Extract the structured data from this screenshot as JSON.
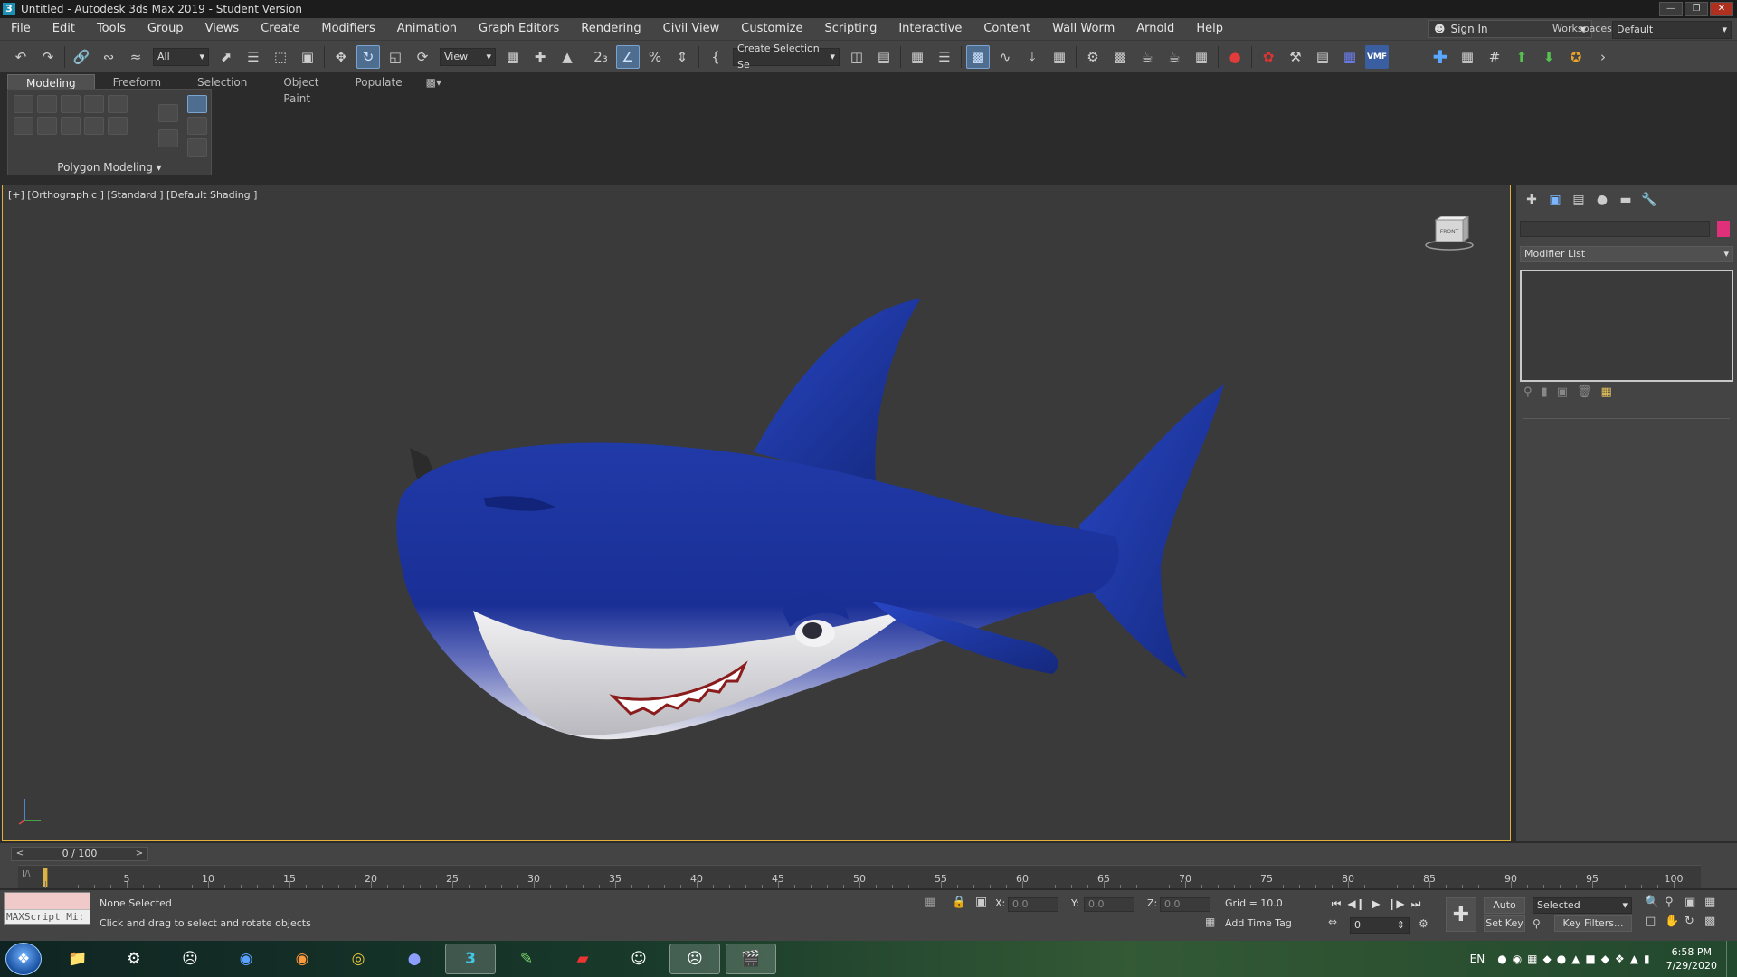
{
  "window": {
    "title": "Untitled - Autodesk 3ds Max 2019 - Student Version",
    "logo": "3"
  },
  "menu": [
    "File",
    "Edit",
    "Tools",
    "Group",
    "Views",
    "Create",
    "Modifiers",
    "Animation",
    "Graph Editors",
    "Rendering",
    "Civil View",
    "Customize",
    "Scripting",
    "Interactive",
    "Content",
    "Wall Worm",
    "Arnold",
    "Help"
  ],
  "account": {
    "sign_in": "Sign In",
    "workspaces_label": "Workspaces:",
    "workspace": "Default"
  },
  "toolbar": {
    "filter": "All",
    "ref_coord": "View",
    "selection_set": "Create Selection Se",
    "vmf_label": "VMF"
  },
  "ribbon": {
    "tabs": [
      "Modeling",
      "Freeform",
      "Selection",
      "Object Paint",
      "Populate"
    ],
    "active_tab": "Modeling",
    "panel": "Polygon Modeling"
  },
  "viewport": {
    "label": "[+] [Orthographic ] [Standard ] [Default Shading ]",
    "viewcube_face": "FRONT",
    "shark_colors": {
      "body": "#1f36a8",
      "belly": "#e8e8ea",
      "background": "#3a3a3a"
    }
  },
  "command_panel": {
    "modifier_list": "Modifier List",
    "color": "#e0307a"
  },
  "timeline": {
    "frame": "0 / 100",
    "ticks": [
      "5",
      "10",
      "15",
      "20",
      "25",
      "30",
      "35",
      "40",
      "45",
      "50",
      "55",
      "60",
      "65",
      "70",
      "75",
      "80",
      "85",
      "90",
      "95",
      "100"
    ],
    "progress": 0
  },
  "status": {
    "maxscript": "MAXScript Mi:",
    "selection": "None Selected",
    "prompt": "Click and drag to select and rotate objects",
    "x_label": "X:",
    "x": "0.0",
    "y_label": "Y:",
    "y": "0.0",
    "z_label": "Z:",
    "z": "0.0",
    "grid": "Grid = 10.0",
    "add_time_tag": "Add Time Tag",
    "auto_key": "Auto Key",
    "key_mode": "Selected",
    "set_key": "Set Key",
    "key_filters": "Key Filters...",
    "frame_field": "0"
  },
  "taskbar": {
    "lang": "EN",
    "time": "6:58 PM",
    "date": "7/29/2020",
    "apps": [
      "folder-icon",
      "steam-icon",
      "gimp-icon",
      "headset-icon",
      "firefox-icon",
      "chrome-icon",
      "discord-icon",
      "3dsmax-icon",
      "notepad-icon",
      "acrobat-icon",
      "cat-mask-icon",
      "gimp-alt-icon",
      "movie-maker-icon"
    ]
  }
}
